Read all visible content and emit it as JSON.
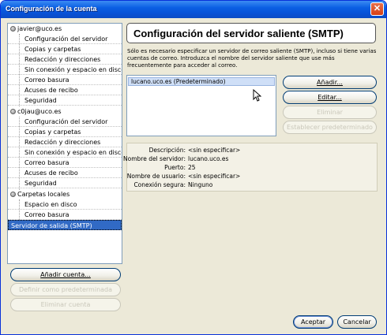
{
  "window": {
    "title": "Configuración de la cuenta",
    "close_symbol": "✕"
  },
  "tree": {
    "account1": {
      "name": "javier@uco.es",
      "children": [
        "Configuración del servidor",
        "Copias y carpetas",
        "Redacción y direcciones",
        "Sin conexión y espacio en disco",
        "Correo basura",
        "Acuses de recibo",
        "Seguridad"
      ]
    },
    "account2": {
      "name": "c0jau@uco.es",
      "children": [
        "Configuración del servidor",
        "Copias y carpetas",
        "Redacción y direcciones",
        "Sin conexión y espacio en disco",
        "Correo basura",
        "Acuses de recibo",
        "Seguridad"
      ]
    },
    "local": {
      "name": "Carpetas locales",
      "children": [
        "Espacio en disco",
        "Correo basura"
      ]
    },
    "smtp": "Servidor de salida (SMTP)"
  },
  "left_buttons": {
    "add_account": "Añadir cuenta...",
    "set_default": "Definir como predeterminada",
    "delete_account": "Eliminar cuenta"
  },
  "panel": {
    "title": "Configuración del servidor saliente (SMTP)",
    "description": "Sólo es necesario especificar un servidor de correo saliente (SMTP), incluso si tiene varias cuentas de correo. Introduzca el nombre del servidor saliente que use más frecuentemente para acceder al correo."
  },
  "server_list": [
    "lucano.uco.es (Predeterminado)"
  ],
  "server_buttons": {
    "add": "Añadir...",
    "edit": "Editar...",
    "delete": "Eliminar",
    "set_default": "Establecer predeterminado"
  },
  "details": [
    {
      "label": "Descripción:",
      "value": "<sin especificar>"
    },
    {
      "label": "Nombre del servidor:",
      "value": "lucano.uco.es"
    },
    {
      "label": "Puerto:",
      "value": "25"
    },
    {
      "label": "Nombre de usuario:",
      "value": "<sin especificar>"
    },
    {
      "label": "Conexión segura:",
      "value": "Ninguno"
    }
  ],
  "footer": {
    "accept": "Aceptar",
    "cancel": "Cancelar"
  }
}
